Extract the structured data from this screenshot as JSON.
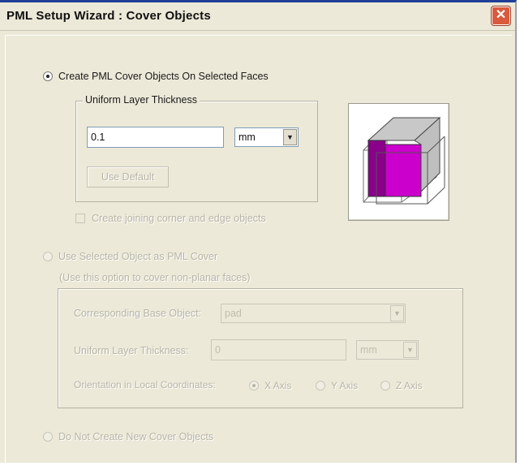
{
  "window": {
    "title": "PML Setup Wizard : Cover Objects"
  },
  "option1": {
    "label": "Create PML Cover Objects On Selected Faces",
    "group_label": "Uniform Layer Thickness",
    "thickness_value": "0.1",
    "unit": "mm",
    "use_default_label": "Use Default",
    "create_joining_label": "Create joining corner and edge objects"
  },
  "option2": {
    "label": "Use Selected Object as PML Cover",
    "hint": "(Use this option to cover non-planar faces)",
    "base_object_label": "Corresponding Base Object:",
    "base_object_value": "pad",
    "thickness_label": "Uniform Layer Thickness:",
    "thickness_value": "0",
    "unit": "mm",
    "orientation_label": "Orientation in Local Coordinates:",
    "axes": [
      "X Axis",
      "Y Axis",
      "Z Axis"
    ]
  },
  "option3": {
    "label": "Do Not Create New Cover Objects"
  },
  "colors": {
    "cube_face": "#cc00cc",
    "cube_side": "#8a008a",
    "cube_top": "#c8c8c8",
    "title_accent": "#1f3e96"
  },
  "icons": {
    "close": "close-icon",
    "dropdown": "chevron-down-icon"
  }
}
